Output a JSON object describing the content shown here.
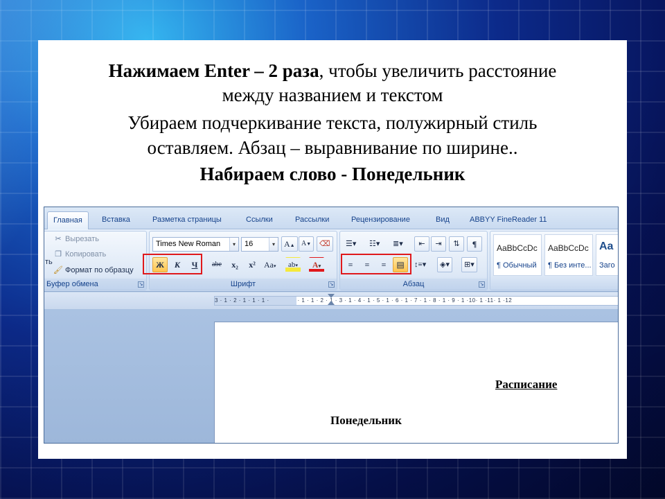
{
  "slide": {
    "line1_bold": "Нажимаем Enter – 2 раза",
    "line1_rest": ", чтобы увеличить расстояние",
    "line2": "между названием и текстом",
    "line3": "Убираем подчеркивание текста, полужирный стиль",
    "line4": "оставляем. Абзац – выравнивание по ширине..",
    "line5": "Набираем слово - Понедельник"
  },
  "ribbon": {
    "tabs": [
      "Главная",
      "Вставка",
      "Разметка страницы",
      "Ссылки",
      "Рассылки",
      "Рецензирование",
      "Вид",
      "ABBYY FineReader 11"
    ],
    "active_tab": "Главная",
    "clipboard": {
      "label": "Буфер обмена",
      "cut": "Вырезать",
      "copy": "Копировать",
      "format_painter": "Формат по образцу",
      "paste_stub": "ть"
    },
    "font": {
      "label": "Шрифт",
      "font_name": "Times New Roman",
      "font_size": "16",
      "grow": "A",
      "shrink": "A",
      "bold": "Ж",
      "italic": "К",
      "underline": "Ч",
      "strikethrough": "abe",
      "subscript": "x₂",
      "superscript": "x²",
      "change_case": "Aa",
      "highlight": "ab",
      "font_color": "A"
    },
    "paragraph": {
      "label": "Абзац",
      "pilcrow": "¶"
    },
    "styles": {
      "tiles": [
        {
          "sample": "AaBbCcDc",
          "name": "¶ Обычный"
        },
        {
          "sample": "AaBbCcDc",
          "name": "¶ Без инте..."
        },
        {
          "sample": "Aa",
          "name": "Заго"
        }
      ]
    }
  },
  "ruler": {
    "text": "3 · 1 · 2 · 1 · 1 · 1 ·               · 1 · 1 · 2 · 1 · 3 · 1 · 4 · 1 · 5 · 1 · 6 · 1 · 7 · 1 · 8 · 1 · 9 · 1 ·10· 1 ·11· 1 ·12"
  },
  "document": {
    "heading": "Расписание",
    "day": "Понедельник"
  },
  "colors": {
    "highlight_red": "#e0181b",
    "active_button": "#ffc44d",
    "ribbon_text": "#15428b"
  }
}
